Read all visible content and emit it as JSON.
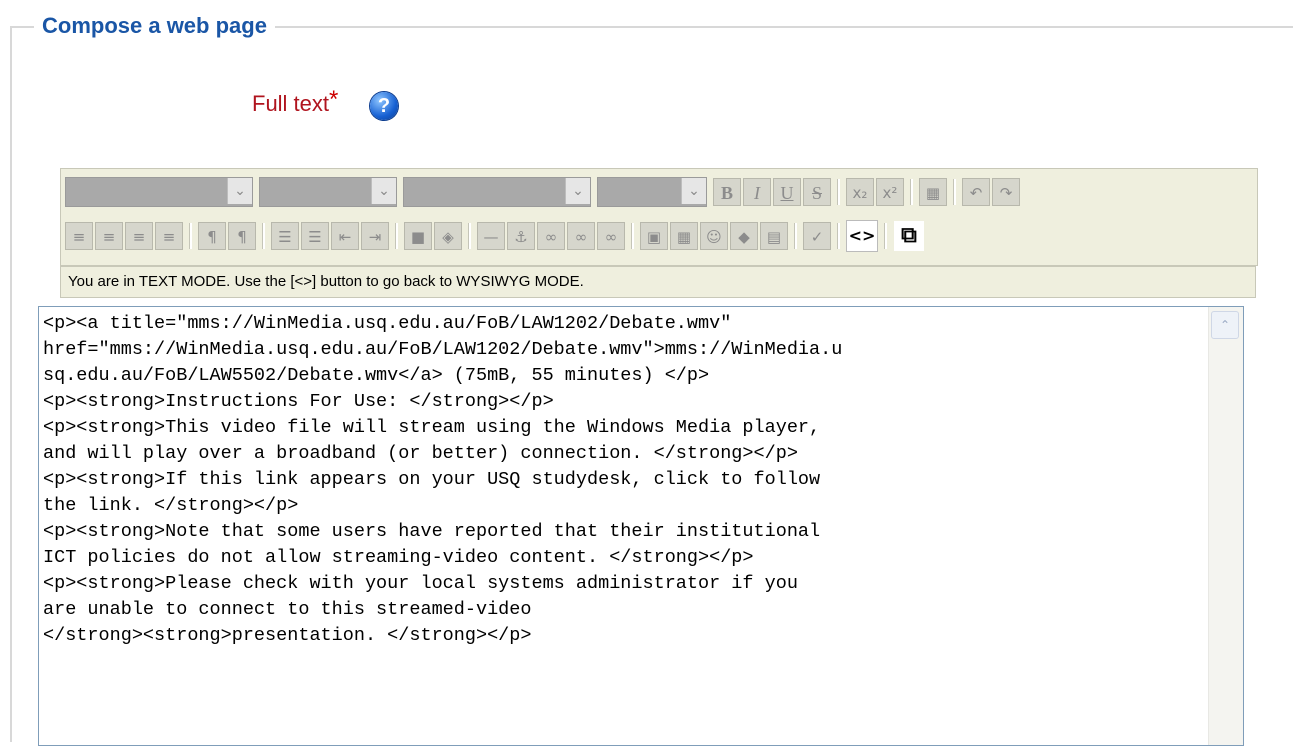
{
  "legend": "Compose a web page",
  "field": {
    "label": "Full text",
    "required_mark": "*",
    "help_glyph": "?"
  },
  "toolbar": {
    "bold": "B",
    "italic": "I",
    "underline": "U",
    "strike": "S",
    "subscript": "x₂",
    "superscript": "x²",
    "undo": "↶",
    "redo": "↷",
    "html_toggle": "<>",
    "fullscreen": "⧉"
  },
  "mode_bar": {
    "text": "You are in TEXT MODE.  Use the [<>] button to go back to WYSIWYG MODE."
  },
  "editor": {
    "content": "<p><a title=\"mms://WinMedia.usq.edu.au/FoB/LAW1202/Debate.wmv\"\nhref=\"mms://WinMedia.usq.edu.au/FoB/LAW1202/Debate.wmv\">mms://WinMedia.u\nsq.edu.au/FoB/LAW5502/Debate.wmv</a> (75mB, 55 minutes) </p>\n<p><strong>Instructions For Use: </strong></p>\n<p><strong>This video file will stream using the Windows Media player,\nand will play over a broadband (or better) connection. </strong></p>\n<p><strong>If this link appears on your USQ studydesk, click to follow\nthe link. </strong></p>\n<p><strong>Note that some users have reported that their institutional\nICT policies do not allow streaming-video content. </strong></p>\n<p><strong>Please check with your local systems administrator if you\nare unable to connect to this streamed-video\n</strong><strong>presentation. </strong></p>"
  },
  "colors": {
    "legend": "#1a56a6",
    "label": "#b0141e",
    "toolbar_bg": "#efefde"
  }
}
